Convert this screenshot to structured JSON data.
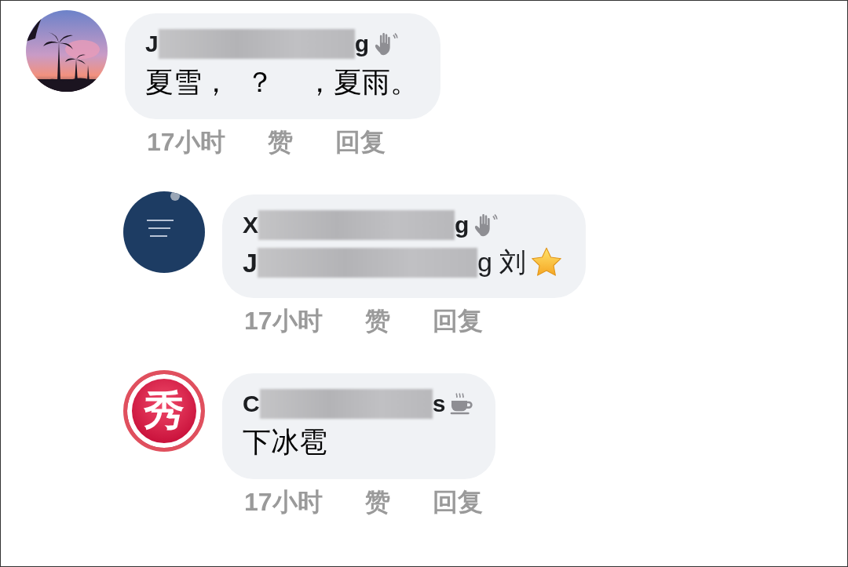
{
  "comments": [
    {
      "name": {
        "start": "J",
        "end": "g",
        "redacted": true
      },
      "badge": {
        "kind": "wave"
      },
      "message": {
        "start": "夏雪，  ？    ，夏雨。",
        "redacted": false
      },
      "meta": {
        "time": "17小时",
        "like": "赞",
        "reply": "回复"
      },
      "reply": false
    },
    {
      "name": {
        "start": "X",
        "end": "g",
        "redacted": true
      },
      "badge": {
        "kind": "wave"
      },
      "message": {
        "start": "J",
        "end": "g 刘",
        "redacted": true,
        "emoji": {
          "kind": "star"
        }
      },
      "meta": {
        "time": "17小时",
        "like": "赞",
        "reply": "回复"
      },
      "reply": true
    },
    {
      "avatar": {
        "kind": "logo",
        "label": "秀"
      },
      "name": {
        "start": "C",
        "end": "s",
        "redacted": true
      },
      "badge": {
        "kind": "cup"
      },
      "message": {
        "start": "下冰雹",
        "redacted": false
      },
      "meta": {
        "time": "17小时",
        "like": "赞",
        "reply": "回复"
      },
      "reply": true
    }
  ]
}
